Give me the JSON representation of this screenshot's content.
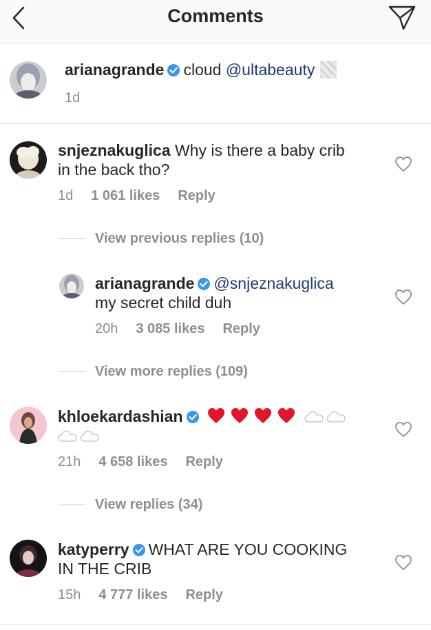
{
  "header": {
    "title": "Comments",
    "back_icon": "chevron-left-icon",
    "send_icon": "paper-plane-icon"
  },
  "caption": {
    "username": "arianagrande",
    "verified": true,
    "text": "cloud",
    "mention": "@ultabeauty",
    "time": "1d"
  },
  "comments": [
    {
      "username": "snjeznakuglica",
      "verified": false,
      "line1": "Why is there a baby crib",
      "line2": "in the back tho?",
      "time": "1d",
      "likes": "1 061 likes",
      "reply": "Reply",
      "view_replies": "View previous replies (10)",
      "replies": [
        {
          "username": "arianagrande",
          "verified": true,
          "mention": "@snjeznakuglica",
          "line2": "my secret child duh",
          "time": "20h",
          "likes": "3 085 likes",
          "reply": "Reply"
        }
      ],
      "view_more": "View more replies (109)"
    },
    {
      "username": "khloekardashian",
      "verified": true,
      "emojis": "❤️❤️❤️❤️ ☁️☁️ ☁️☁️",
      "time": "21h",
      "likes": "4 658 likes",
      "reply": "Reply",
      "view_replies": "View replies (34)"
    },
    {
      "username": "katyperry",
      "verified": true,
      "line1": "WHAT ARE YOU COOKING",
      "line2": "IN THE CRIB",
      "time": "15h",
      "likes": "4 777 likes",
      "reply": "Reply"
    }
  ],
  "colors": {
    "verified": "#3897f0",
    "mention": "#1f3a72",
    "meta": "#8e8e8e",
    "heart_emoji": "#e0162b"
  }
}
